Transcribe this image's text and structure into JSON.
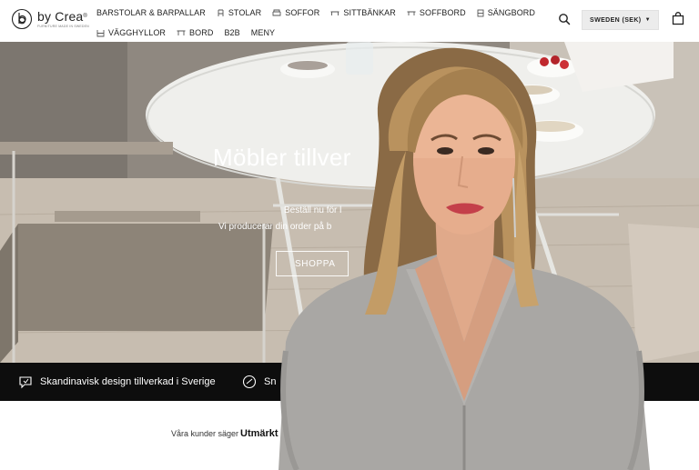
{
  "brand": {
    "name": "by Crea",
    "trademark": "®",
    "tagline": "FURNITURE MADE IN SWEDEN"
  },
  "nav": {
    "row1": [
      {
        "label": "BARSTOLAR & BARPALLAR",
        "icon": ""
      },
      {
        "label": "STOLAR",
        "icon": "chair-icon"
      },
      {
        "label": "SOFFOR",
        "icon": "sofa-icon"
      },
      {
        "label": "SITTBÄNKAR",
        "icon": "bench-icon"
      },
      {
        "label": "SOFFBORD",
        "icon": "coffee-table-icon"
      },
      {
        "label": "SÄNGBORD",
        "icon": "nightstand-icon"
      }
    ],
    "row2": [
      {
        "label": "VÄGGHYLLOR",
        "icon": "shelf-icon"
      },
      {
        "label": "BORD",
        "icon": "table-icon"
      },
      {
        "label": "B2B",
        "icon": ""
      },
      {
        "label": "MENY",
        "icon": ""
      }
    ]
  },
  "header": {
    "region_label": "SWEDEN (SEK)",
    "search_icon": "search-icon",
    "cart_icon": "shopping-bag-icon"
  },
  "hero": {
    "title": "Möbler tillver",
    "subtitle_line1": "Beställ nu för l",
    "subtitle_line2": "Vi producerar din order på b",
    "cta_label": "SHOPPA"
  },
  "usp": {
    "item1": "Skandinavisk design tillverkad i Sverige",
    "item1_icon": "chat-icon",
    "item2": "Sn",
    "item2_icon": "fast-icon"
  },
  "reviews": {
    "label": "Våra kunder säger",
    "score": "Utmärkt",
    "star_color": "#00b67a"
  },
  "colors": {
    "accent_dark": "#0d0d0d",
    "region_bg": "#ececec",
    "trustpilot_green": "#00b67a"
  }
}
